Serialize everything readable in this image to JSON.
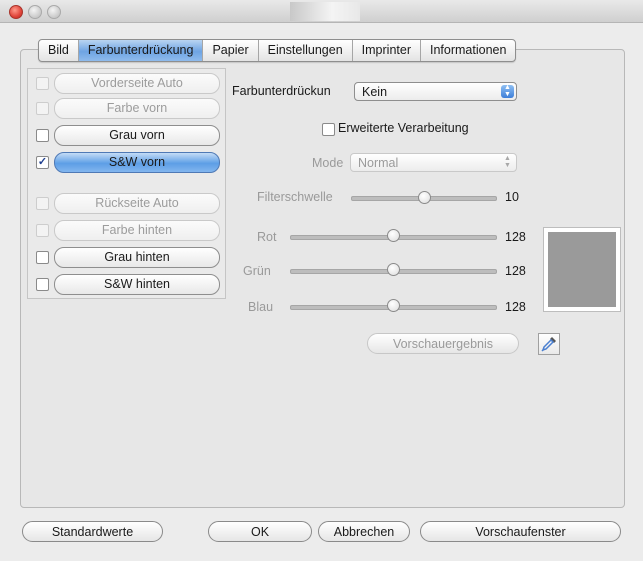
{
  "tabs": [
    "Bild",
    "Farbunterdrückung",
    "Papier",
    "Einstellungen",
    "Imprinter",
    "Informationen"
  ],
  "side_items": [
    {
      "label": "Vorderseite Auto",
      "checked": false,
      "enabled": false
    },
    {
      "label": "Farbe vorn",
      "checked": false,
      "enabled": false
    },
    {
      "label": "Grau vorn",
      "checked": false,
      "enabled": true
    },
    {
      "label": "S&W vorn",
      "checked": true,
      "enabled": true
    },
    {
      "label": "Rückseite Auto",
      "checked": false,
      "enabled": false
    },
    {
      "label": "Farbe hinten",
      "checked": false,
      "enabled": false
    },
    {
      "label": "Grau hinten",
      "checked": false,
      "enabled": true
    },
    {
      "label": "S&W hinten",
      "checked": false,
      "enabled": true
    }
  ],
  "dropout": {
    "label": "Farbunterdrückun",
    "value": "Kein"
  },
  "advanced": {
    "label": "Erweiterte Verarbeitung",
    "checked": false
  },
  "mode": {
    "label": "Mode",
    "value": "Normal"
  },
  "sliders": {
    "filter": {
      "label": "Filterschwelle",
      "value": "10"
    },
    "red": {
      "label": "Rot",
      "value": "128"
    },
    "green": {
      "label": "Grün",
      "value": "128"
    },
    "blue": {
      "label": "Blau",
      "value": "128"
    }
  },
  "preview_button": "Vorschauergebnis",
  "footer": {
    "defaults": "Standardwerte",
    "ok": "OK",
    "cancel": "Abbrechen",
    "preview_window": "Vorschaufenster"
  },
  "colors": {
    "preview_swatch": "#9a9a9a",
    "selected": "#5d9ee6"
  },
  "icons": {
    "eyedropper": "eyedropper-icon",
    "close": "close-icon"
  }
}
